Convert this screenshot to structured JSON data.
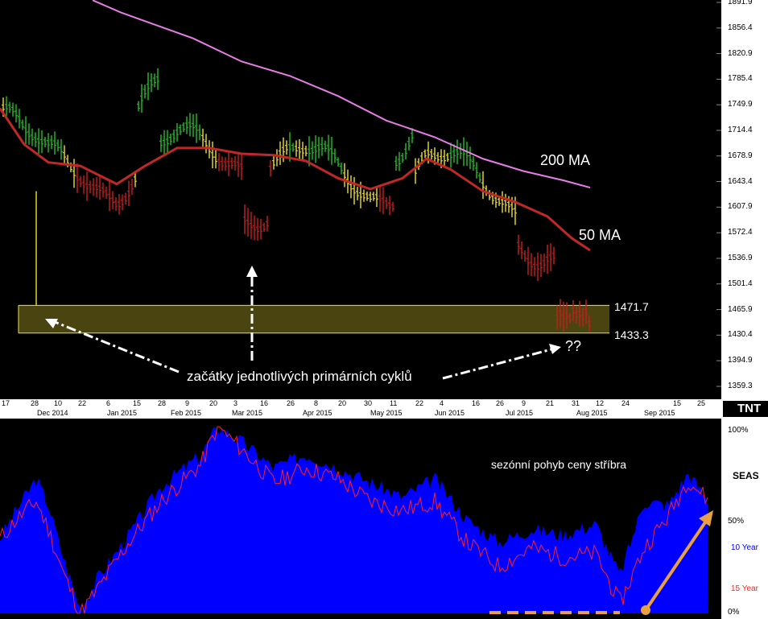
{
  "colors": {
    "background": "#000000",
    "price_up": "#22c022",
    "price_neutral": "#f0e020",
    "price_down": "#c81e1e",
    "ma200": "#e87ce8",
    "ma50": "#c02828",
    "band_fill": "#4a4410",
    "band_line": "#f0e040",
    "seasonal_fill": "#0000ff",
    "seasonal_15yr": "#ff2020",
    "arrow": "#e8a040"
  },
  "annotations": {
    "ma200_label": "200 MA",
    "ma50_label": "50 MA",
    "level_upper": "1471.7",
    "level_lower": "1433.3",
    "question": "??",
    "cycles_text": "začátky jednotlivých primárních cyklů",
    "seasonal_title": "sezónní pohyb ceny stříbra"
  },
  "seas_axis": {
    "title": "SEAS",
    "top": "100%",
    "mid": "50%",
    "bottom": "0%",
    "legend_10": "10 Year",
    "legend_15": "15 Year"
  },
  "logo": "TNT",
  "chart_data": [
    {
      "type": "bar",
      "subtype": "ohlc-price",
      "y_ticks": [
        "1891.9",
        "1856.4",
        "1820.9",
        "1785.4",
        "1749.9",
        "1714.4",
        "1678.9",
        "1643.4",
        "1607.9",
        "1572.4",
        "1536.9",
        "1501.4",
        "1465.9",
        "1430.4",
        "1394.9",
        "1359.3"
      ],
      "ylim": [
        1340,
        1895
      ],
      "x_day_ticks": [
        "17",
        "28",
        "10",
        "22",
        "6",
        "15",
        "28",
        "9",
        "20",
        "3",
        "16",
        "26",
        "8",
        "20",
        "30",
        "11",
        "22",
        "4",
        "16",
        "26",
        "9",
        "21",
        "31",
        "12",
        "24",
        "15",
        "25"
      ],
      "x_month_ticks": [
        "Dec 2014",
        "Jan 2015",
        "Feb 2015",
        "Mar 2015",
        "Apr 2015",
        "May 2015",
        "Jun 2015",
        "Jul 2015",
        "Aug 2015",
        "Sep 2015"
      ],
      "series": [
        {
          "name": "200 MA",
          "points": [
            [
              115,
              1895
            ],
            [
              150,
              1878
            ],
            [
              190,
              1862
            ],
            [
              240,
              1842
            ],
            [
              300,
              1810
            ],
            [
              360,
              1790
            ],
            [
              420,
              1762
            ],
            [
              480,
              1728
            ],
            [
              540,
              1705
            ],
            [
              600,
              1675
            ],
            [
              650,
              1658
            ],
            [
              700,
              1645
            ],
            [
              733,
              1635
            ]
          ]
        },
        {
          "name": "50 MA",
          "points": [
            [
              0,
              1745
            ],
            [
              30,
              1695
            ],
            [
              60,
              1670
            ],
            [
              100,
              1665
            ],
            [
              145,
              1640
            ],
            [
              180,
              1665
            ],
            [
              220,
              1690
            ],
            [
              260,
              1690
            ],
            [
              300,
              1682
            ],
            [
              340,
              1680
            ],
            [
              380,
              1672
            ],
            [
              420,
              1648
            ],
            [
              460,
              1633
            ],
            [
              500,
              1648
            ],
            [
              530,
              1675
            ],
            [
              560,
              1660
            ],
            [
              600,
              1630
            ],
            [
              640,
              1615
            ],
            [
              680,
              1595
            ],
            [
              710,
              1565
            ],
            [
              733,
              1548
            ]
          ]
        }
      ],
      "levels": [
        1471.7,
        1433.3
      ]
    },
    {
      "type": "area",
      "title": "sezónní pohyb ceny stříbra",
      "ylim": [
        0,
        100
      ],
      "y_ticks": [
        "100%",
        "50%",
        "0%"
      ],
      "series": [
        {
          "name": "10 Year",
          "points": [
            [
              0,
              40
            ],
            [
              20,
              55
            ],
            [
              45,
              72
            ],
            [
              60,
              58
            ],
            [
              80,
              28
            ],
            [
              100,
              2
            ],
            [
              120,
              18
            ],
            [
              160,
              42
            ],
            [
              200,
              68
            ],
            [
              250,
              85
            ],
            [
              270,
              100
            ],
            [
              300,
              92
            ],
            [
              340,
              78
            ],
            [
              380,
              85
            ],
            [
              420,
              78
            ],
            [
              460,
              70
            ],
            [
              500,
              62
            ],
            [
              540,
              72
            ],
            [
              580,
              50
            ],
            [
              620,
              38
            ],
            [
              660,
              45
            ],
            [
              700,
              42
            ],
            [
              740,
              48
            ],
            [
              770,
              20
            ],
            [
              800,
              60
            ],
            [
              830,
              58
            ],
            [
              855,
              75
            ],
            [
              880,
              60
            ]
          ]
        },
        {
          "name": "15 Year",
          "points": [
            [
              0,
              40
            ],
            [
              20,
              50
            ],
            [
              45,
              60
            ],
            [
              60,
              45
            ],
            [
              80,
              20
            ],
            [
              100,
              0
            ],
            [
              120,
              12
            ],
            [
              160,
              38
            ],
            [
              200,
              60
            ],
            [
              250,
              80
            ],
            [
              270,
              100
            ],
            [
              300,
              88
            ],
            [
              340,
              70
            ],
            [
              380,
              78
            ],
            [
              420,
              72
            ],
            [
              460,
              60
            ],
            [
              500,
              55
            ],
            [
              540,
              60
            ],
            [
              580,
              38
            ],
            [
              620,
              25
            ],
            [
              660,
              35
            ],
            [
              700,
              30
            ],
            [
              740,
              32
            ],
            [
              770,
              5
            ],
            [
              800,
              35
            ],
            [
              830,
              52
            ],
            [
              855,
              72
            ],
            [
              880,
              60
            ]
          ]
        }
      ]
    }
  ]
}
